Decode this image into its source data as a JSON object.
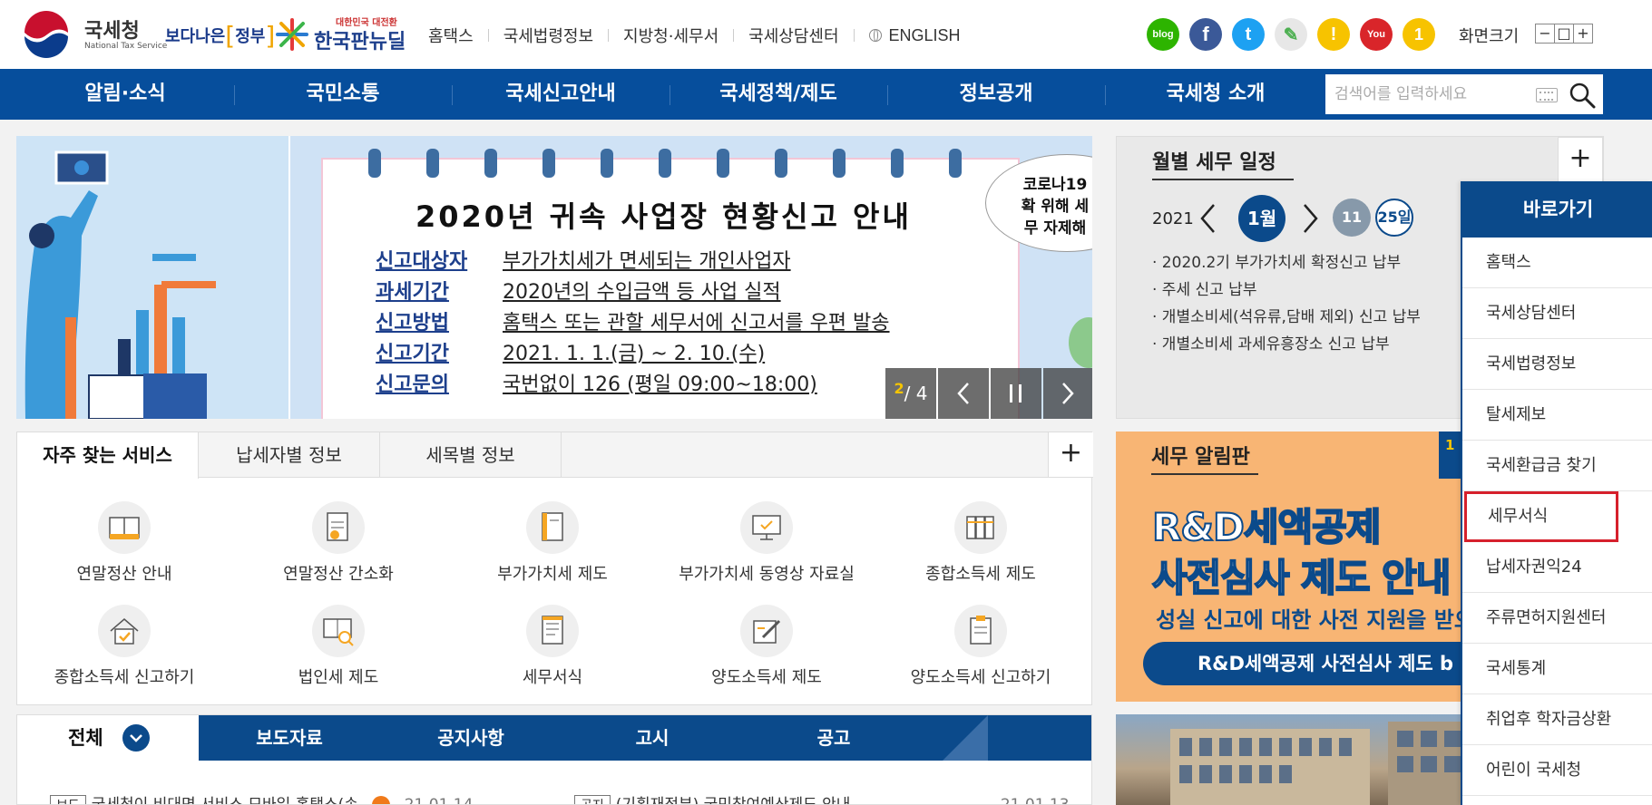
{
  "header": {
    "logo_title": "국세청",
    "logo_sub": "National Tax Service",
    "logo2_main": "보다나은",
    "logo2_accent": "정부",
    "logo3_top": "대한민국 대전환",
    "logo3_main": "한국판뉴딜",
    "links": [
      "홈택스",
      "국세법령정보",
      "지방청·세무서",
      "국세상담센터",
      "ENGLISH"
    ],
    "social": [
      {
        "name": "blog",
        "label": "blog",
        "color": "#2db400"
      },
      {
        "name": "facebook",
        "label": "f",
        "color": "#3b5998"
      },
      {
        "name": "twitter",
        "label": "t",
        "color": "#1da1f2"
      },
      {
        "name": "phone",
        "label": "✎",
        "color": "#e7e7e7"
      },
      {
        "name": "kakao",
        "label": "!",
        "color": "#f7c300"
      },
      {
        "name": "youtube",
        "label": "You",
        "color": "#d9252a"
      },
      {
        "name": "kakaostory",
        "label": "1",
        "color": "#f7c300"
      }
    ],
    "screen_size_label": "화면크기",
    "size_buttons": [
      "−",
      "□",
      "+"
    ]
  },
  "nav": {
    "items": [
      "알림·소식",
      "국민소통",
      "국세신고안내",
      "국세정책/제도",
      "정보공개",
      "국세청 소개"
    ],
    "search_placeholder": "검색어를 입력하세요"
  },
  "banner": {
    "title": "2020년 귀속 사업장 현황신고 안내",
    "rows": [
      {
        "key": "신고대상자",
        "value": "부가가치세가 면세되는 개인사업자"
      },
      {
        "key": "과세기간",
        "value": "2020년의 수입금액 등 사업 실적"
      },
      {
        "key": "신고방법",
        "value": "홈택스 또는 관할 세무서에 신고서를 우편 발송"
      },
      {
        "key": "신고기간",
        "value": "2021. 1. 1.(금) ~ 2. 10.(수)"
      },
      {
        "key": "신고문의",
        "value": "국번없이 126 (평일 09:00~18:00)"
      }
    ],
    "bubble_text": "코로나19 확 위해 세무 자제해",
    "pager_current": "2",
    "pager_total": "/ 4"
  },
  "schedule": {
    "title": "월별 세무 일정",
    "year": "2021",
    "month": "1월",
    "day_a": "11",
    "day_b": "25일",
    "items": [
      "· 2020.2기 부가가치세 확정신고 납부",
      "· 주세 신고 납부",
      "· 개별소비세(석유류,담배 제외) 신고 납부",
      "· 개별소비세 과세유흥장소 신고 납부"
    ]
  },
  "services": {
    "tabs": [
      "자주 찾는 서비스",
      "납세자별 정보",
      "세목별 정보"
    ],
    "items": [
      "연말정산 안내",
      "연말정산 간소화",
      "부가가치세 제도",
      "부가가치세 동영상 자료실",
      "종합소득세 제도",
      "종합소득세 신고하기",
      "법인세 제도",
      "세무서식",
      "양도소득세 제도",
      "양도소득세 신고하기"
    ]
  },
  "notice": {
    "title": "세무 알림판",
    "pager": "1",
    "headline1": "R&D세액공제",
    "headline2": "사전심사 제도 안내",
    "sub": "성실 신고에 대한 사전 지원을 받으",
    "pill": "R&D세액공제 사전심사 제도 b"
  },
  "news": {
    "tab_all": "전체",
    "tabs": [
      "보도자료",
      "공지사항",
      "고시",
      "공고"
    ],
    "row1_tag": "보도",
    "row1_text": "국세청이 비대면 서비스 모바일 홈택스(손",
    "row1_date": "21.01.14",
    "row2_tag": "공지",
    "row2_text": "(기획재정부) 국민참여예산제도 안내",
    "row2_date": "21.01.13"
  },
  "quick": {
    "title": "바로가기",
    "items": [
      "홈택스",
      "국세상담센터",
      "국세법령정보",
      "탈세제보",
      "국세환급금 찾기",
      "세무서식",
      "납세자권익24",
      "주류면허지원센터",
      "국세통계",
      "취업후 학자금상환",
      "어린이 국세청"
    ],
    "selected_index": 5
  },
  "colors": {
    "primary": "#064e9c",
    "dark_blue": "#0b4a8b",
    "highlight": "#d6202c",
    "pager_yellow": "#f5c400"
  }
}
